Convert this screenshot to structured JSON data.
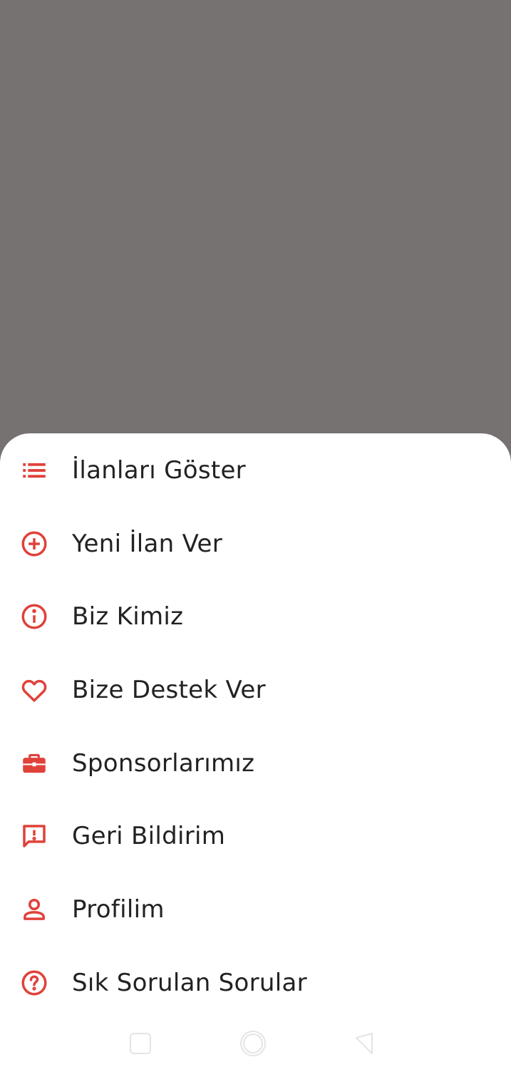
{
  "colors": {
    "accent": "#e0413a",
    "scrim": "#757271",
    "sheet": "#ffffff",
    "text": "#222222"
  },
  "menu": {
    "items": [
      {
        "label": "İlanları Göster",
        "icon": "list-icon"
      },
      {
        "label": "Yeni İlan Ver",
        "icon": "add-circle-icon"
      },
      {
        "label": "Biz Kimiz",
        "icon": "info-icon"
      },
      {
        "label": "Bize Destek Ver",
        "icon": "heart-icon"
      },
      {
        "label": "Sponsorlarımız",
        "icon": "briefcase-icon"
      },
      {
        "label": "Geri Bildirim",
        "icon": "feedback-icon"
      },
      {
        "label": "Profilim",
        "icon": "person-icon"
      },
      {
        "label": "Sık Sorulan Sorular",
        "icon": "help-icon"
      }
    ]
  },
  "navbar": {
    "buttons": [
      "recent-apps-icon",
      "home-icon",
      "back-icon"
    ]
  }
}
